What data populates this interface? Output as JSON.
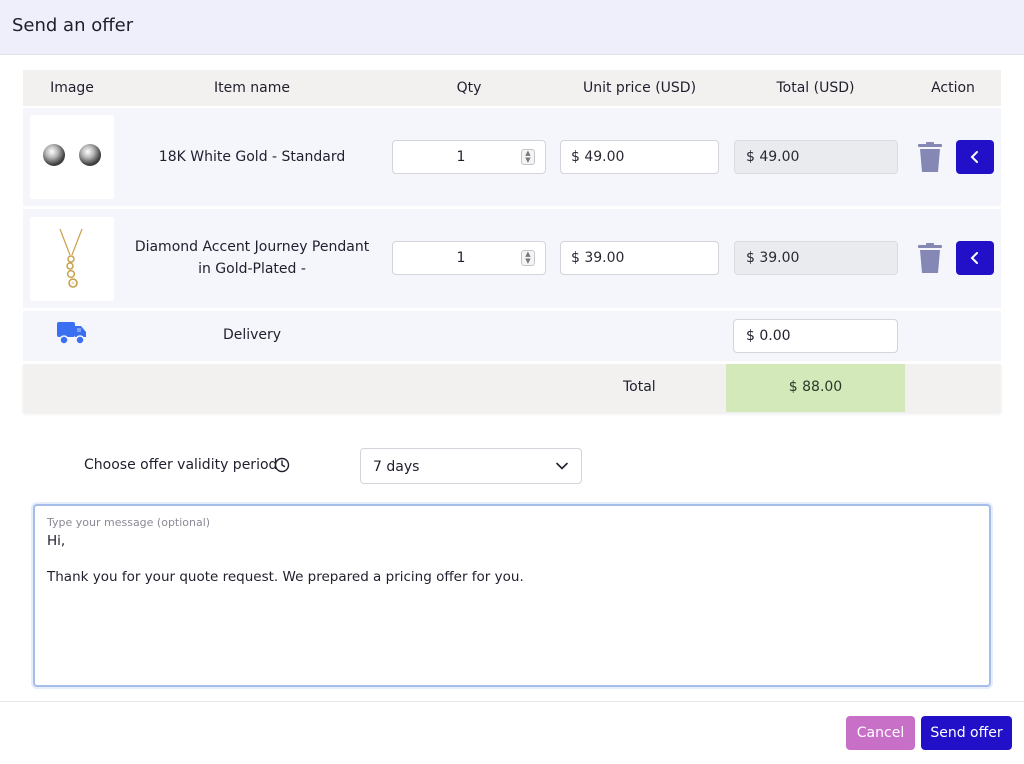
{
  "dialog": {
    "title": "Send an offer"
  },
  "table": {
    "headers": {
      "image": "Image",
      "item_name": "Item name",
      "qty": "Qty",
      "unit_price": "Unit price (USD)",
      "total": "Total (USD)",
      "action": "Action"
    },
    "items": [
      {
        "name": "18K White Gold - Standard",
        "qty": "1",
        "unit_price": "$ 49.00",
        "total": "$ 49.00",
        "image_icon": "stud-earrings-image"
      },
      {
        "name": "Diamond Accent Journey Pendant in Gold-Plated -",
        "qty": "1",
        "unit_price": "$ 39.00",
        "total": "$ 39.00",
        "image_icon": "pendant-necklace-image"
      }
    ],
    "delivery": {
      "label": "Delivery",
      "value": "$ 0.00",
      "icon": "truck-icon"
    },
    "grand_total": {
      "label": "Total",
      "value": "$ 88.00"
    }
  },
  "validity": {
    "label": "Choose offer validity period",
    "selected": "7 days"
  },
  "message": {
    "placeholder": "Type your message (optional)",
    "line1": "Hi,",
    "line2": "Thank you for your quote request. We prepared a pricing offer for you."
  },
  "buttons": {
    "cancel": "Cancel",
    "send": "Send offer"
  },
  "colors": {
    "primary": "#2210c9",
    "cancel": "#c86fc8",
    "total_highlight": "#d3e9b9",
    "trash": "#8588b4",
    "truck": "#3b6ff2"
  }
}
